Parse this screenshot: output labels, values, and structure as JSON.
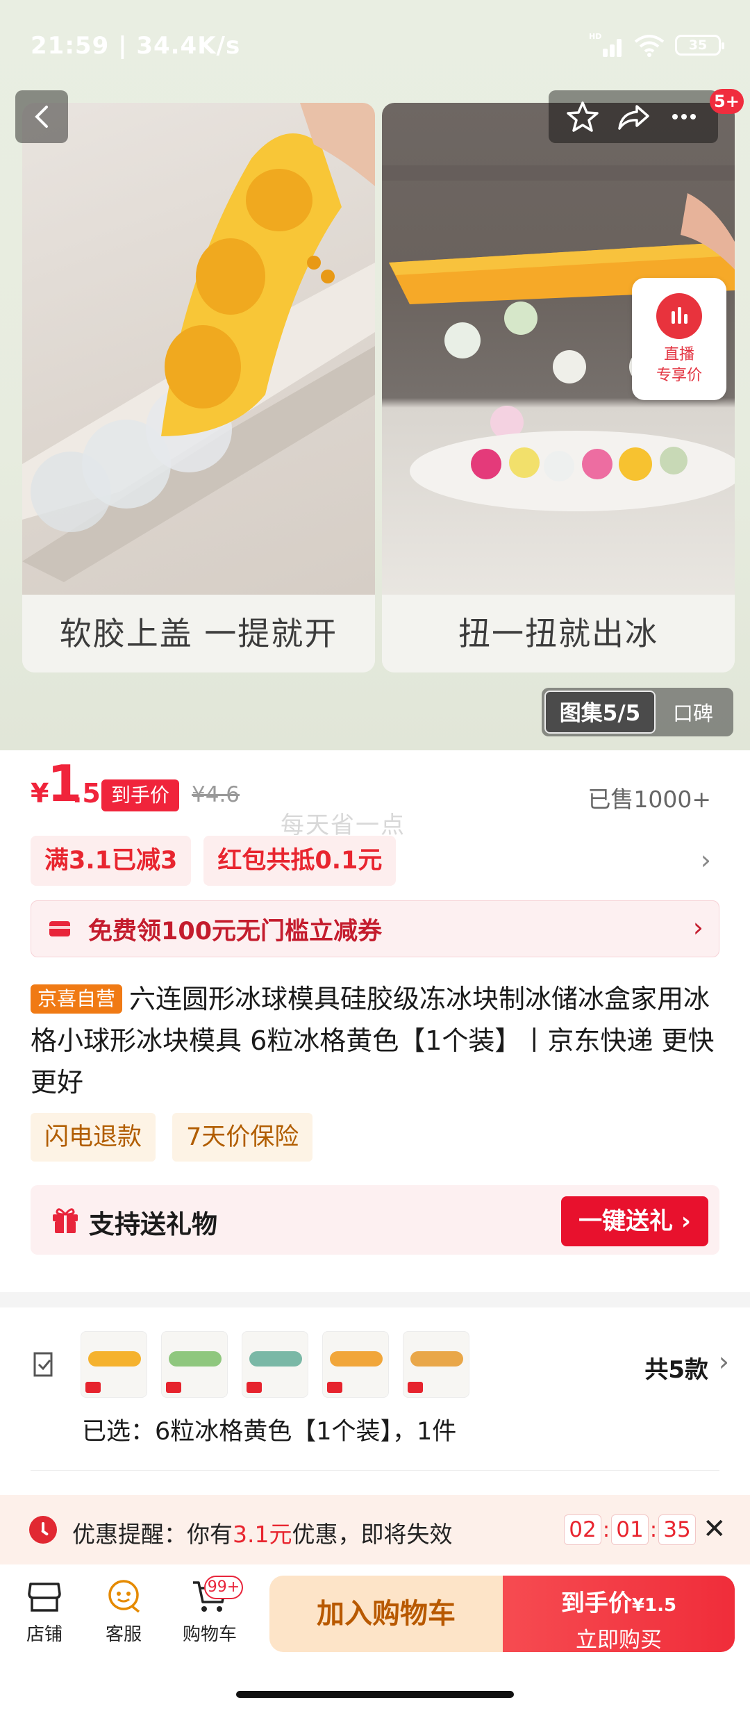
{
  "status": {
    "time_speed": "21:59 | 34.4K/s",
    "signal_label": "HD",
    "battery": "35"
  },
  "hero": {
    "cart_count_badge": "5+",
    "cards": [
      {
        "caption": "软胶上盖 一提就开"
      },
      {
        "caption": "扭一扭就出冰"
      }
    ],
    "live": {
      "line1": "直播",
      "line2": "专享价"
    },
    "gallery": {
      "active_label": "图集5/5",
      "other_label": "口碑"
    }
  },
  "price": {
    "currency": "¥",
    "integer": "1",
    "decimal": ".5",
    "tag": "到手价",
    "original": "¥4.6",
    "sold": "已售1000+",
    "watermark": "每天省一点"
  },
  "promos": {
    "chips": [
      "满3.1已减3",
      "红包共抵0.1元"
    ]
  },
  "coupon": {
    "text": "免费领100元无门槛立减券"
  },
  "product": {
    "badge": "京喜自营",
    "title": "六连圆形冰球模具硅胶级冻冰块制冰储冰盒家用冰格小球形冰块模具 6粒冰格黄色【1个装】丨京东快递 更快更好"
  },
  "services": [
    "闪电退款",
    "7天价保险"
  ],
  "gift": {
    "text": "支持送礼物",
    "button": "一键送礼"
  },
  "variants": {
    "count_label": "共5款",
    "selected": "已选：6粒冰格黄色【1个装】，1件"
  },
  "reminder": {
    "prefix": "优惠提醒：你有",
    "amount": "3.1元",
    "suffix": "优惠，即将失效",
    "timer": {
      "h": "02",
      "m": "01",
      "s": "35"
    }
  },
  "bottom": {
    "nav": [
      {
        "label": "店铺"
      },
      {
        "label": "客服"
      },
      {
        "label": "购物车"
      }
    ],
    "cart_badge": "99+",
    "add_to_cart": "加入购物车",
    "buy": {
      "line1_prefix": "到手价",
      "line1_price": "¥1.5",
      "line2": "立即购买"
    }
  },
  "colors": {
    "brand_red": "#f0243b",
    "orange": "#f07a14"
  }
}
